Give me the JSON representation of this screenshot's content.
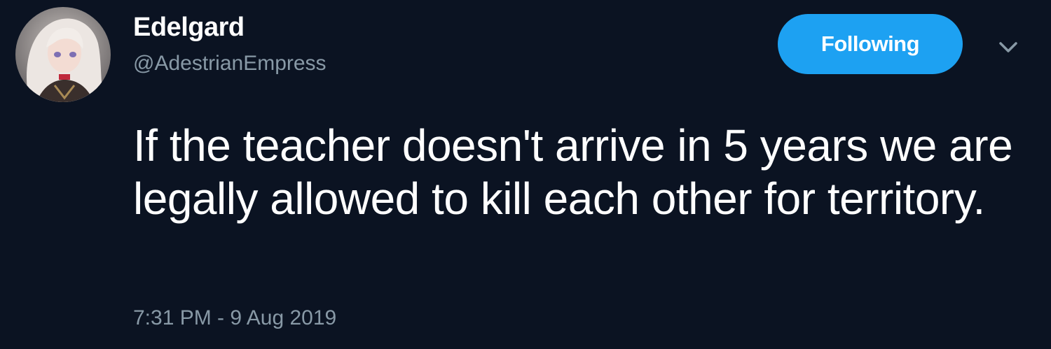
{
  "user": {
    "display_name": "Edelgard",
    "handle": "@AdestrianEmpress",
    "avatar_icon": "profile-avatar"
  },
  "actions": {
    "follow_label": "Following",
    "menu_icon": "chevron-down-icon"
  },
  "tweet": {
    "text": "If the teacher doesn't arrive in 5 years we are legally allowed to kill each other for territory.",
    "timestamp": "7:31 PM - 9 Aug 2019"
  },
  "colors": {
    "background": "#0b1322",
    "accent": "#1da1f2",
    "secondary_text": "#8899a6"
  }
}
